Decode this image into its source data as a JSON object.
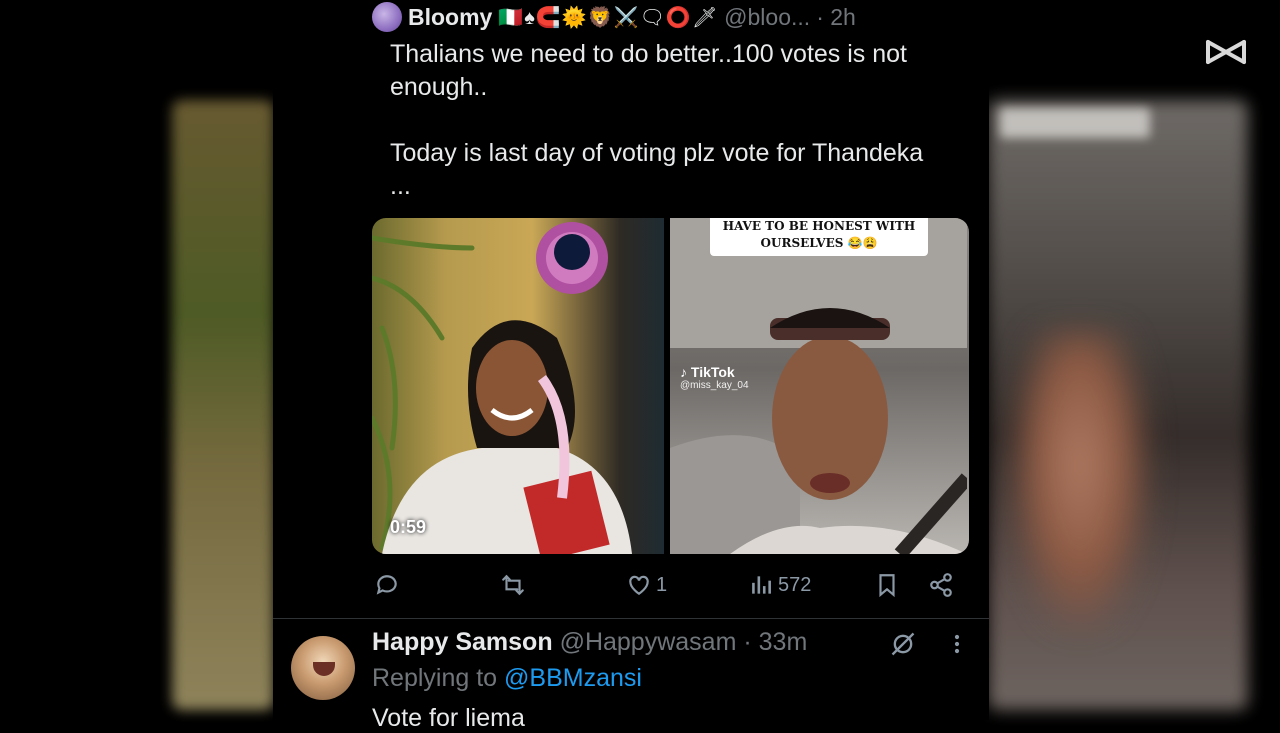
{
  "tweet": {
    "display_name": "Bloomy",
    "name_emojis": "🇮🇹♠🧲🌞🦁⚔️🗨⭕🗡",
    "handle": "@bloo...",
    "time": "· 2h",
    "text": "Thalians we need to do better..100 votes is not enough..\n\nToday is last day of voting plz vote for Thandeka\n...",
    "video": {
      "duration": "0:59",
      "caption": "HAVE TO BE HONEST WITH OURSELVES 😂😩",
      "tiktok_label": "TikTok",
      "tiktok_user": "@miss_kay_04"
    },
    "actions": {
      "reply_count": "",
      "retweet_count": "",
      "like_count": "1",
      "views_count": "572"
    }
  },
  "reply": {
    "display_name": "Happy Samson",
    "handle": "@Happywasam",
    "time": "· 33m",
    "replying_prefix": "Replying to ",
    "replying_to": "@BBMzansi",
    "text": "Vote for liema"
  },
  "colors": {
    "background": "#000000",
    "text": "#e7e9ea",
    "muted": "#71767b",
    "accent": "#1d9bf0"
  }
}
